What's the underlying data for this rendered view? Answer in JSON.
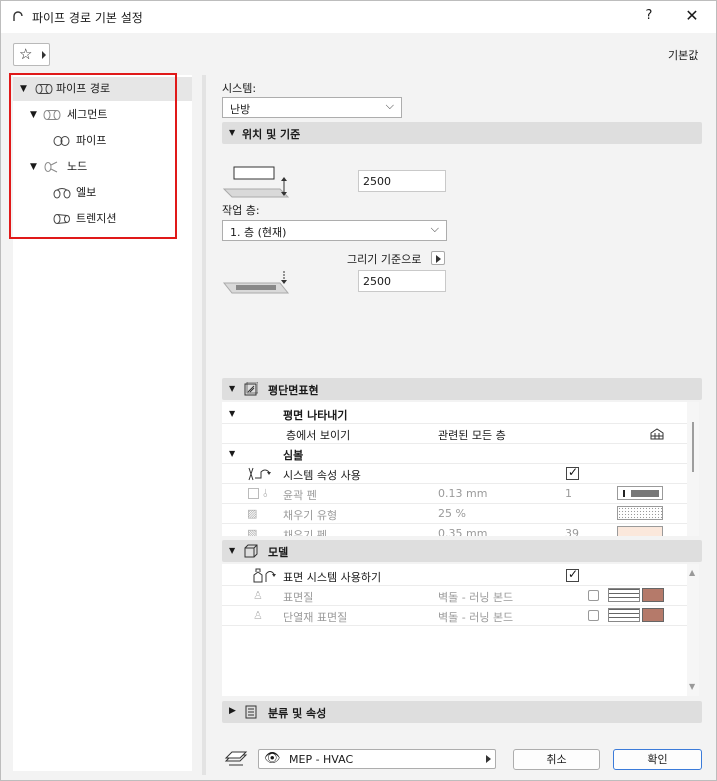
{
  "title": "파이프 경로 기본 설정",
  "title_help": "?",
  "title_close": "✕",
  "toolbar": {
    "defaults_label": "기본값"
  },
  "tree": {
    "items": [
      {
        "label": "파이프 경로",
        "level": 0,
        "expanded": true,
        "selected": true
      },
      {
        "label": "세그먼트",
        "level": 1,
        "expanded": true
      },
      {
        "label": "파이프",
        "level": 2
      },
      {
        "label": "노드",
        "level": 1,
        "expanded": true
      },
      {
        "label": "엘보",
        "level": 2
      },
      {
        "label": "트렌지션",
        "level": 2
      }
    ]
  },
  "system": {
    "label": "시스템:",
    "value": "난방"
  },
  "position": {
    "section_title": "위치 및 기준",
    "top_offset": "2500",
    "story_label": "작업 층:",
    "story_value": "1. 층 (현재)",
    "reference_label": "그리기 기준으로",
    "bottom_offset": "2500"
  },
  "floorplan": {
    "section_title": "평단면표현",
    "rows": [
      {
        "type": "group",
        "label": "평면 나타내기"
      },
      {
        "type": "row",
        "label": "층에서 보이기",
        "value": "관련된 모든 층"
      },
      {
        "type": "group",
        "label": "심볼"
      },
      {
        "type": "row",
        "label": "시스템 속성 사용",
        "checked": true
      },
      {
        "type": "row",
        "label": "윤곽 펜",
        "value": "0.13 mm",
        "num": "1",
        "dim": true
      },
      {
        "type": "row",
        "label": "채우기 유형",
        "value": "25 %",
        "dim": true
      },
      {
        "type": "row",
        "label": "채우기 펜",
        "value": "0.35 mm",
        "num": "39",
        "dim": true
      }
    ]
  },
  "model": {
    "section_title": "모델",
    "rows": [
      {
        "label": "표면 시스템 사용하기",
        "checked": true
      },
      {
        "label": "표면질",
        "value": "벽돌 - 러닝 본드",
        "dim": true
      },
      {
        "label": "단열재 표면질",
        "value": "벽돌 - 러닝 본드",
        "dim": true
      }
    ]
  },
  "classification": {
    "section_title": "분류 및 속성"
  },
  "footer": {
    "layer_value": "MEP - HVAC",
    "cancel": "취소",
    "ok": "확인"
  },
  "colors": {
    "accent_border": "#3b7bd9",
    "highlight_box": "#e01919",
    "brick_color": "#b57a6a"
  },
  "icons": [
    "arc-icon",
    "star-icon",
    "pipe-icon",
    "elbow-icon",
    "transition-icon",
    "close-icon"
  ]
}
